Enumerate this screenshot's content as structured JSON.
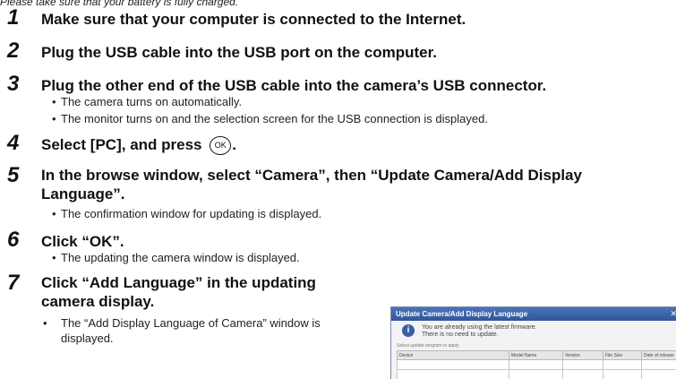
{
  "intro": "Please take sure that your battery is fully charged.",
  "steps": [
    {
      "num": "1",
      "text": "Make sure that your computer is connected to the Internet."
    },
    {
      "num": "2",
      "text": "Plug the USB cable into the USB port on the computer."
    },
    {
      "num": "3",
      "text": "Plug the other end of the USB cable into the camera’s USB connector."
    },
    {
      "num": "4",
      "text_before": "Select [PC], and press",
      "text_after": "."
    },
    {
      "num": "5",
      "text": "In the browse window, select “Camera”, then “Update Camera/Add Display Language”."
    },
    {
      "num": "6",
      "text": "Click “OK”."
    },
    {
      "num": "7",
      "text": "Click “Add Language” in the updating camera display."
    }
  ],
  "bullets": {
    "step3_a": "The camera turns on automatically.",
    "step3_b": "The monitor turns on and the selection screen for the USB connection is displayed.",
    "step5_a": "The confirmation window for updating is displayed.",
    "step6_a": "The updating the camera window is displayed.",
    "step7_a": "The “Add Display Language of Camera” window is displayed."
  },
  "icons": {
    "ok_button": "OK"
  },
  "dialog": {
    "title": "Update Camera/Add Display Language",
    "close": "✕",
    "info_icon": "i",
    "message_line1": "You are already using the latest firmware.",
    "message_line2": "There is no need to update.",
    "select_label": "Select update program to apply",
    "columns": [
      "Device",
      "Model Name",
      "Version",
      "File Size",
      "Date of release"
    ]
  }
}
